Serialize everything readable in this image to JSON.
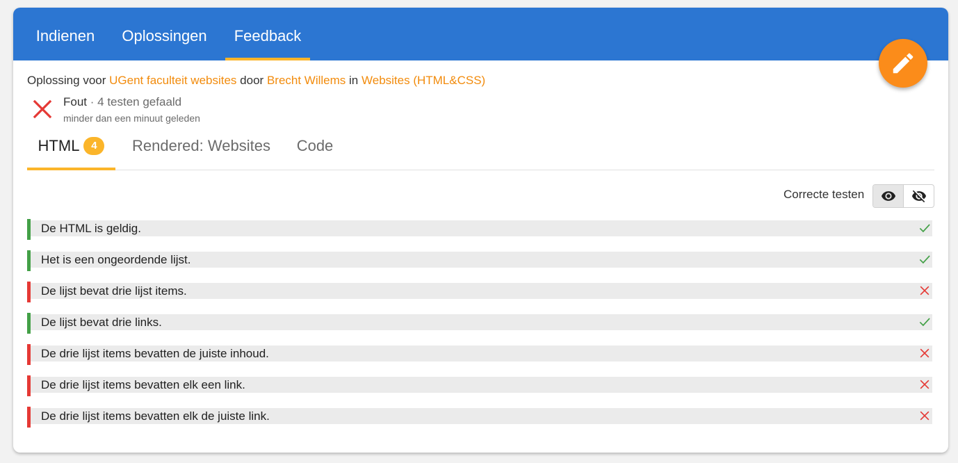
{
  "topbar": {
    "tabs": [
      {
        "label": "Indienen",
        "active": false
      },
      {
        "label": "Oplossingen",
        "active": false
      },
      {
        "label": "Feedback",
        "active": true
      }
    ],
    "accent": "#fbb52a",
    "background": "#2c76d2"
  },
  "fab": {
    "icon": "pencil-icon",
    "color": "#fb8c1a"
  },
  "submission": {
    "prefix": "Oplossing voor",
    "exercise": "UGent faculteit websites",
    "by": "door",
    "user": "Brecht Willems",
    "in": "in",
    "course": "Websites (HTML&CSS)"
  },
  "status": {
    "label": "Fout",
    "separator": " · ",
    "detail": "4 testen gefaald",
    "time": "minder dan een minuut geleden",
    "icon": "error-x-icon"
  },
  "tabs": [
    {
      "label": "HTML",
      "badge": "4",
      "active": true
    },
    {
      "label": "Rendered: Websites",
      "active": false
    },
    {
      "label": "Code",
      "active": false
    }
  ],
  "toggle": {
    "label": "Correcte testen",
    "show_icon": "eye-icon",
    "hide_icon": "eye-off-icon",
    "selected": "show"
  },
  "tests": [
    {
      "text": "De HTML is geldig.",
      "status": "pass"
    },
    {
      "text": "Het is een ongeordende lijst.",
      "status": "pass"
    },
    {
      "text": "De lijst bevat drie lijst items.",
      "status": "fail"
    },
    {
      "text": "De lijst bevat drie links.",
      "status": "pass"
    },
    {
      "text": "De drie lijst items bevatten de juiste inhoud.",
      "status": "fail"
    },
    {
      "text": "De drie lijst items bevatten elk een link.",
      "status": "fail"
    },
    {
      "text": "De drie lijst items bevatten elk de juiste link.",
      "status": "fail"
    }
  ],
  "colors": {
    "pass": "#43a047",
    "fail": "#e53935",
    "link": "#f28b0c"
  }
}
